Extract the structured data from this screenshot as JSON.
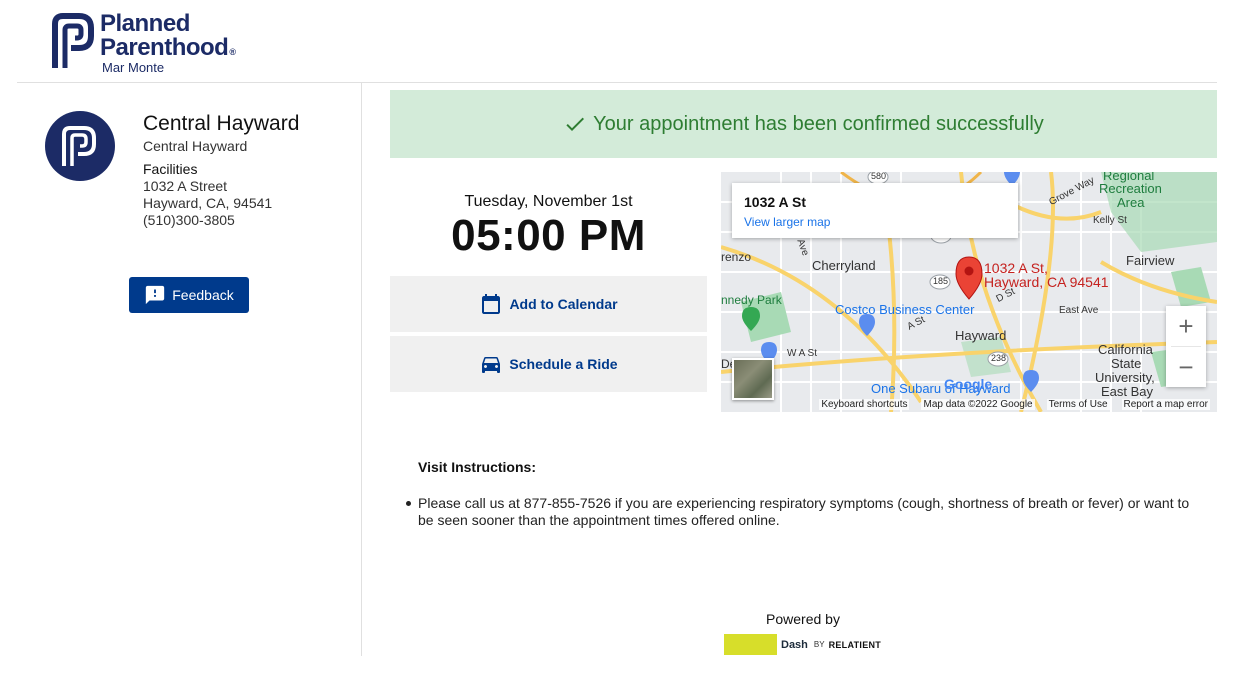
{
  "brand": {
    "line1": "Planned",
    "line2": "Parenthood",
    "line3": "Mar Monte",
    "color": "#1c2b66"
  },
  "clinic": {
    "name": "Central Hayward",
    "subtitle": "Central Hayward",
    "type": "Facilities",
    "street": "1032 A Street",
    "city": "Hayward, CA, 94541",
    "phone": "(510)300-3805",
    "icon": "planned-parenthood-logo"
  },
  "feedback": {
    "label": "Feedback",
    "icon": "feedback-icon",
    "color": "#003a8c"
  },
  "banner": {
    "text": "Your appointment has been confirmed successfully",
    "icon": "check-icon",
    "bg": "#d3ebd9",
    "color": "#2e7d32"
  },
  "appointment": {
    "date": "Tuesday, November 1st",
    "time": "05:00 PM"
  },
  "actions": {
    "add_calendar": "Add to Calendar",
    "schedule_ride": "Schedule a Ride"
  },
  "map": {
    "card_title": "1032 A St",
    "card_link": "View larger map",
    "pin_label_1": "1032 A St,",
    "pin_label_2": "Hayward, CA 94541",
    "labels": {
      "regional": "Regional",
      "recreation": "Recreation",
      "area": "Area",
      "grove_way": "Grove Way",
      "kelly_st": "Kelly St",
      "fairview": "Fairview",
      "lorenzo": "renzo",
      "cherryland": "Cherryland",
      "kennedy_park": "nnedy Park",
      "costco": "Costco Business Center",
      "a_st": "A St",
      "d_st": "D St",
      "east_ave": "East Ave",
      "hayward": "Hayward",
      "california": "California",
      "state": "State",
      "university": "University,",
      "east_bay": "East Bay",
      "w_a_st": "W A St",
      "one_subaru": "One Subaru of Hayward",
      "de": "De",
      "r185": "185",
      "r238": "238",
      "r580": "580",
      "ave": "Ave"
    },
    "google": "Google",
    "footer": {
      "shortcuts": "Keyboard shortcuts",
      "data": "Map data ©2022 Google",
      "terms": "Terms of Use",
      "report": "Report a map error"
    },
    "zoom_in": "+",
    "zoom_out": "−"
  },
  "visit": {
    "title": "Visit Instructions:",
    "items": [
      "Please call us at 877-855-7526 if you are experiencing respiratory symptoms (cough, shortness of breath or fever) or want to be seen sooner than the appointment times offered online."
    ]
  },
  "footer": {
    "powered_by": "Powered by",
    "dash": "Dash",
    "by": "BY",
    "relatient": "RELATIENT",
    "accent": "#d7de2a"
  }
}
